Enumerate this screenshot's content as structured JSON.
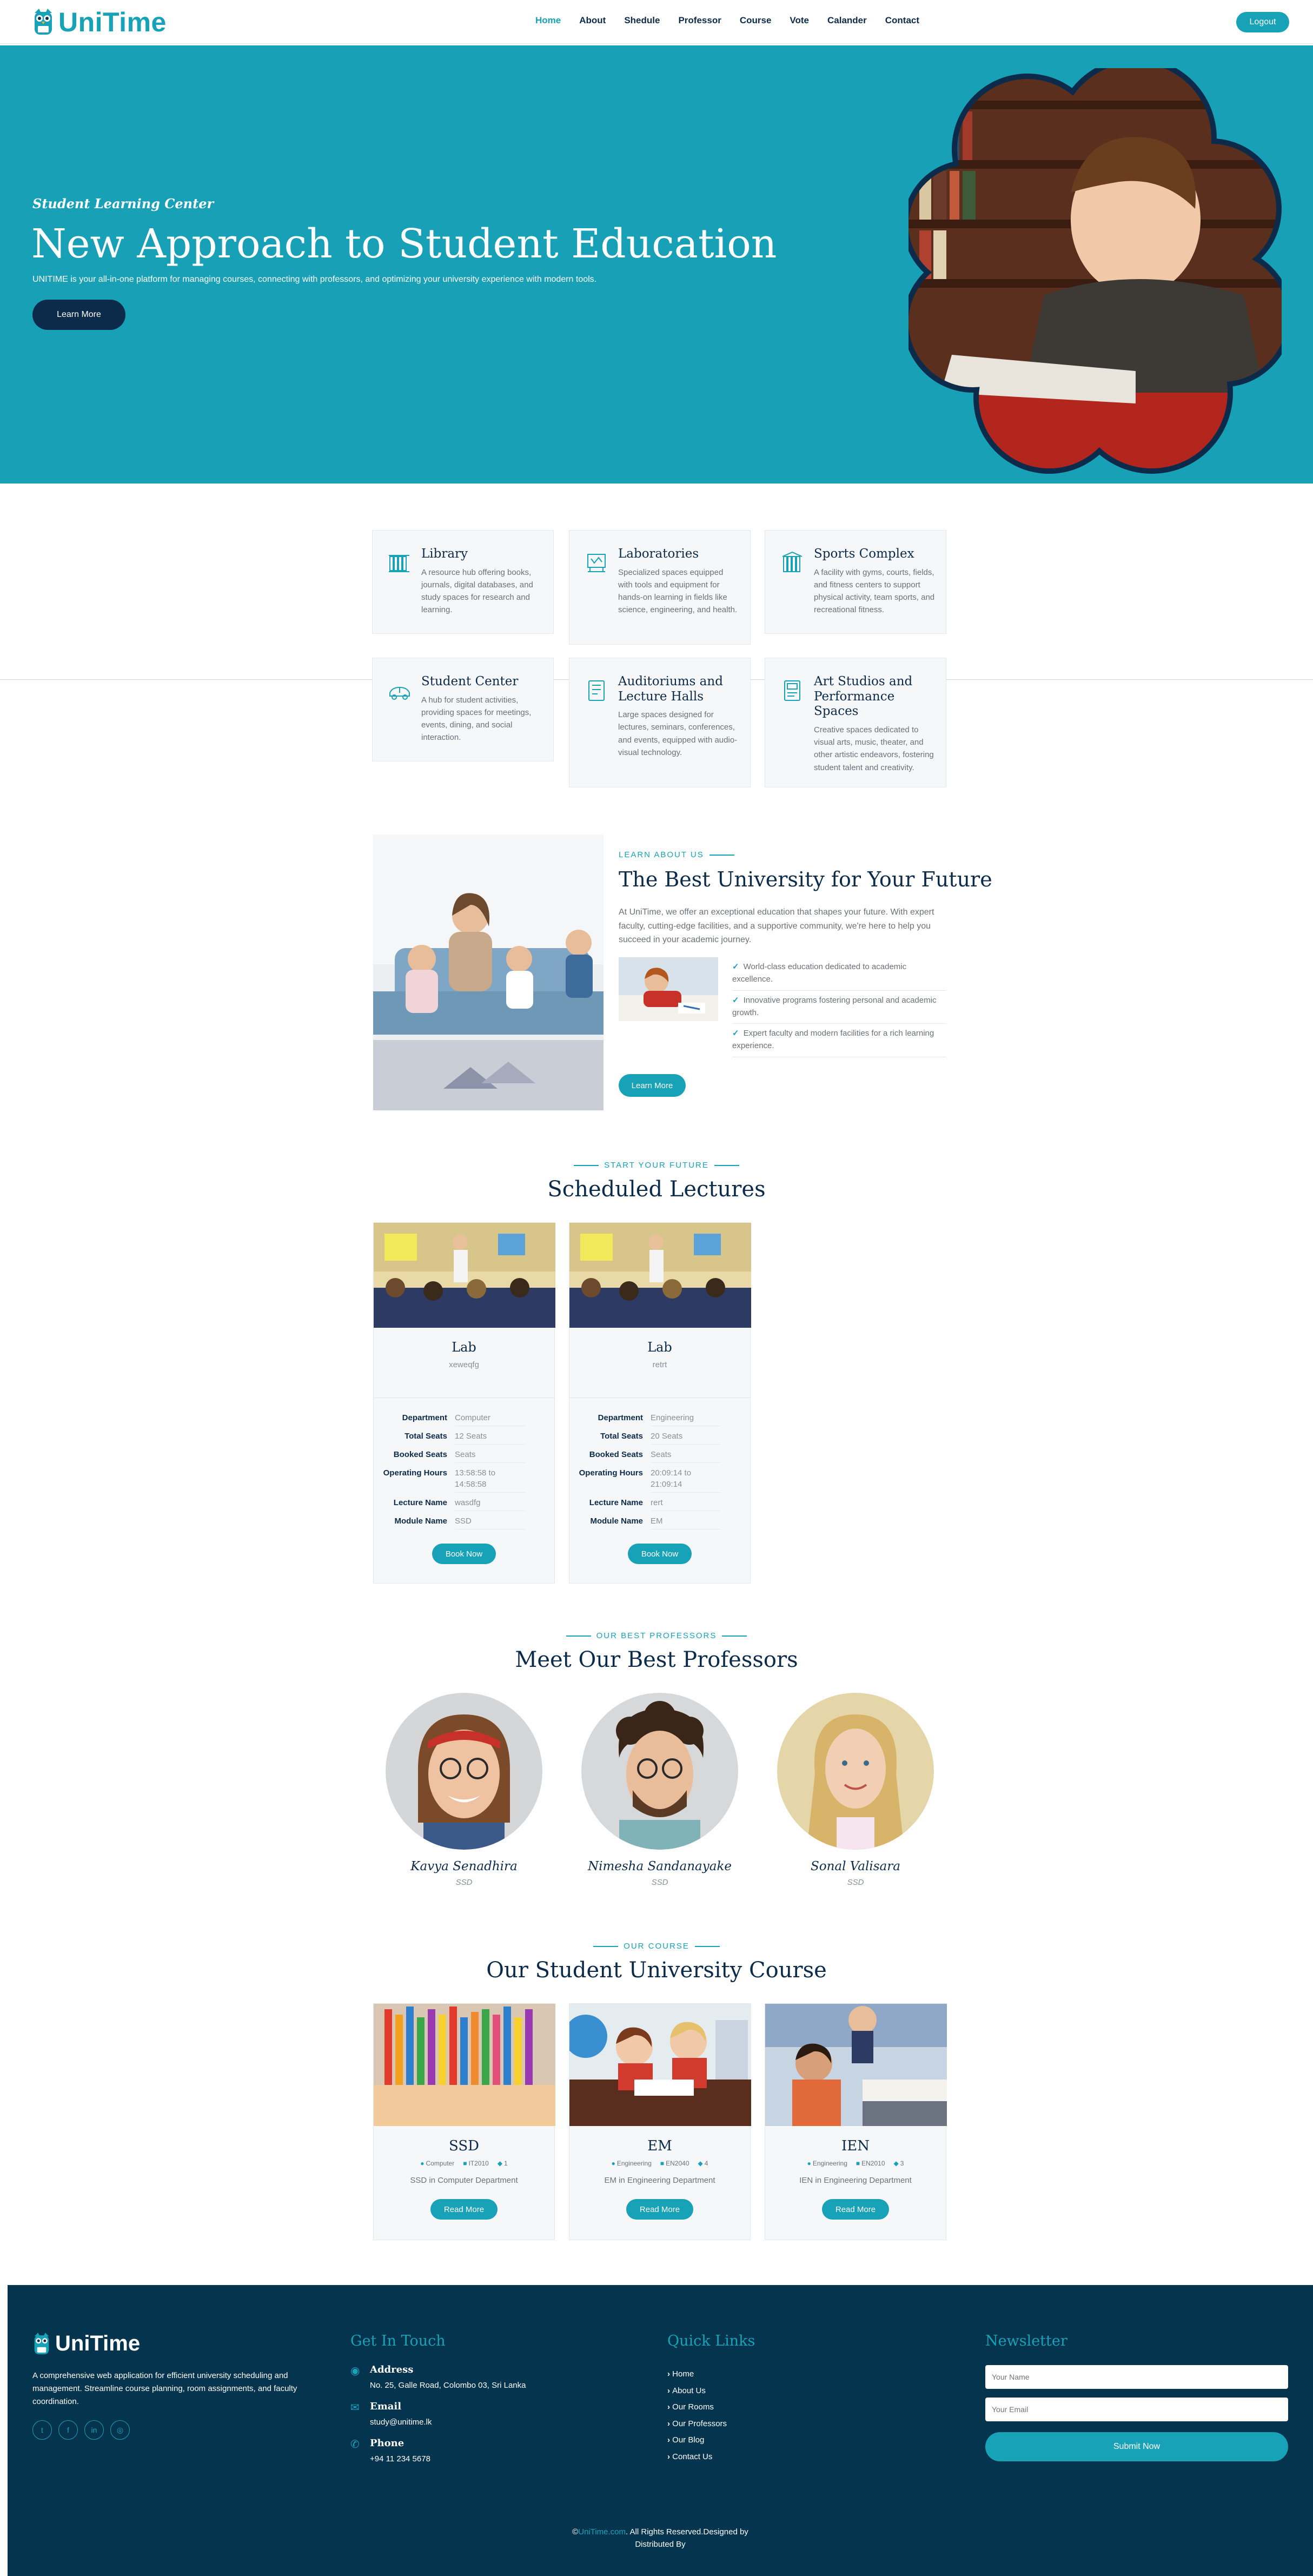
{
  "colors": {
    "primary": "#17a2b8",
    "dark": "#0c2b4b",
    "footer": "#05344f"
  },
  "nav": {
    "brand": "UniTime",
    "items": [
      "Home",
      "About",
      "Shedule",
      "Professor",
      "Course",
      "Vote",
      "Calander",
      "Contact"
    ],
    "active": "Home",
    "logout": "Logout"
  },
  "hero": {
    "subtitle": "Student Learning Center",
    "title": "New Approach to Student Education",
    "description": "UNITIME is your all-in-one platform for managing courses, connecting with professors, and optimizing your university experience with modern tools.",
    "button": "Learn More"
  },
  "facilities": [
    {
      "icon": "library-icon",
      "title": "Library",
      "text": "A resource hub offering books, journals, digital databases, and study spaces for research and learning."
    },
    {
      "icon": "laboratory-icon",
      "title": "Laboratories",
      "text": "Specialized spaces equipped with tools and equipment for hands-on learning in fields like science, engineering, and health."
    },
    {
      "icon": "sports-complex-icon",
      "title": "Sports Complex",
      "text": "A facility with gyms, courts, fields, and fitness centers to support physical activity, team sports, and recreational fitness."
    },
    {
      "icon": "student-center-icon",
      "title": "Student Center",
      "text": "A hub for student activities, providing spaces for meetings, events, dining, and social interaction."
    },
    {
      "icon": "auditorium-icon",
      "title": "Auditoriums and Lecture Halls",
      "text": "Large spaces designed for lectures, seminars, conferences, and events, equipped with audio-visual technology."
    },
    {
      "icon": "art-studio-icon",
      "title": "Art Studios and Performance Spaces",
      "text": "Creative spaces dedicated to visual arts, music, theater, and other artistic endeavors, fostering student talent and creativity."
    }
  ],
  "about": {
    "eyebrow": "LEARN ABOUT US",
    "title": "The Best University for Your Future",
    "text": "At UniTime, we offer an exceptional education that shapes your future. With expert faculty, cutting-edge facilities, and a supportive community, we're here to help you succeed in your academic journey.",
    "checks": [
      "World-class education dedicated to academic excellence.",
      "Innovative programs fostering personal and academic growth.",
      "Expert faculty and modern facilities for a rich learning experience."
    ],
    "button": "Learn More"
  },
  "lectures": {
    "eyebrow": "START YOUR FUTURE",
    "title": "Scheduled Lectures",
    "labels": {
      "department": "Department",
      "total": "Total Seats",
      "booked": "Booked Seats",
      "hours": "Operating Hours",
      "lecturer": "Lecture Name",
      "module": "Module Name"
    },
    "button": "Book Now",
    "items": [
      {
        "title": "Lab",
        "sub": "xeweqfg",
        "department": "Computer",
        "total": "12 Seats",
        "booked": "Seats",
        "hours": "13:58:58 to 14:58:58",
        "lecturer": "wasdfg",
        "module": "SSD"
      },
      {
        "title": "Lab",
        "sub": "retrt",
        "department": "Engineering",
        "total": "20 Seats",
        "booked": "Seats",
        "hours": "20:09:14 to 21:09:14",
        "lecturer": "rert",
        "module": "EM"
      }
    ]
  },
  "professors": {
    "eyebrow": "OUR BEST PROFESSORS",
    "title": "Meet Our Best Professors",
    "items": [
      {
        "name": "Kavya Senadhira",
        "dept": "SSD"
      },
      {
        "name": "Nimesha Sandanayake",
        "dept": "SSD"
      },
      {
        "name": "Sonal Valisara",
        "dept": "SSD"
      }
    ]
  },
  "courses": {
    "eyebrow": "OUR COURSE",
    "title": "Our Student University Course",
    "button": "Read More",
    "items": [
      {
        "title": "SSD",
        "dept": "Computer",
        "code": "IT2010",
        "count": "1",
        "desc": "SSD in Computer Department"
      },
      {
        "title": "EM",
        "dept": "Engineering",
        "code": "EN2040",
        "count": "4",
        "desc": "EM in Engineering Department"
      },
      {
        "title": "IEN",
        "dept": "Engineering",
        "code": "EN2010",
        "count": "3",
        "desc": "IEN in Engineering Department"
      }
    ]
  },
  "footer": {
    "brand": "UniTime",
    "description": "A comprehensive web application for efficient university scheduling and management. Streamline course planning, room assignments, and faculty coordination.",
    "contact_heading": "Get In Touch",
    "address_label": "Address",
    "address": "No. 25, Galle Road, Colombo 03, Sri Lanka",
    "email_label": "Email",
    "email": "study@unitime.lk",
    "phone_label": "Phone",
    "phone": "+94 11 234 5678",
    "links_heading": "Quick Links",
    "links": [
      "Home",
      "About Us",
      "Our Rooms",
      "Our Professors",
      "Our Blog",
      "Contact Us"
    ],
    "newsletter_heading": "Newsletter",
    "name_placeholder": "Your Name",
    "email_placeholder": "Your Email",
    "submit": "Submit Now",
    "copyright_prefix": "©",
    "copyright_brand": "UniTime.com",
    "copyright_rest": ". All Rights Reserved.Designed by",
    "distributed": "Distributed By"
  }
}
